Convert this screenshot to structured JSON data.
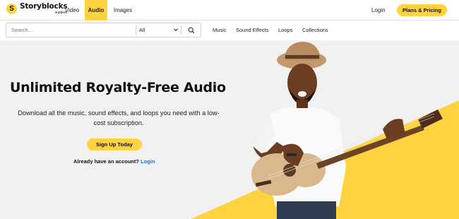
{
  "brand": {
    "logo_letter": "S",
    "name": "Storyblocks",
    "sub": "AUDIO",
    "accent": "#ffd23f",
    "link_color": "#1a73d9"
  },
  "nav": {
    "video": "Video",
    "audio": "Audio",
    "images": "Images"
  },
  "account": {
    "login": "Login",
    "plans": "Plans & Pricing"
  },
  "search": {
    "placeholder": "Search...",
    "category": "All",
    "icon": "search-icon"
  },
  "subnav": {
    "music": "Music",
    "sound_effects": "Sound Effects",
    "loops": "Loops",
    "collections": "Collections"
  },
  "hero": {
    "title": "Unlimited Royalty-Free Audio",
    "description": "Download all the music, sound effects, and loops you need with a low-cost subscription.",
    "cta": "Sign Up Today",
    "account_prompt": "Already have an account?",
    "login_link": "Login"
  }
}
